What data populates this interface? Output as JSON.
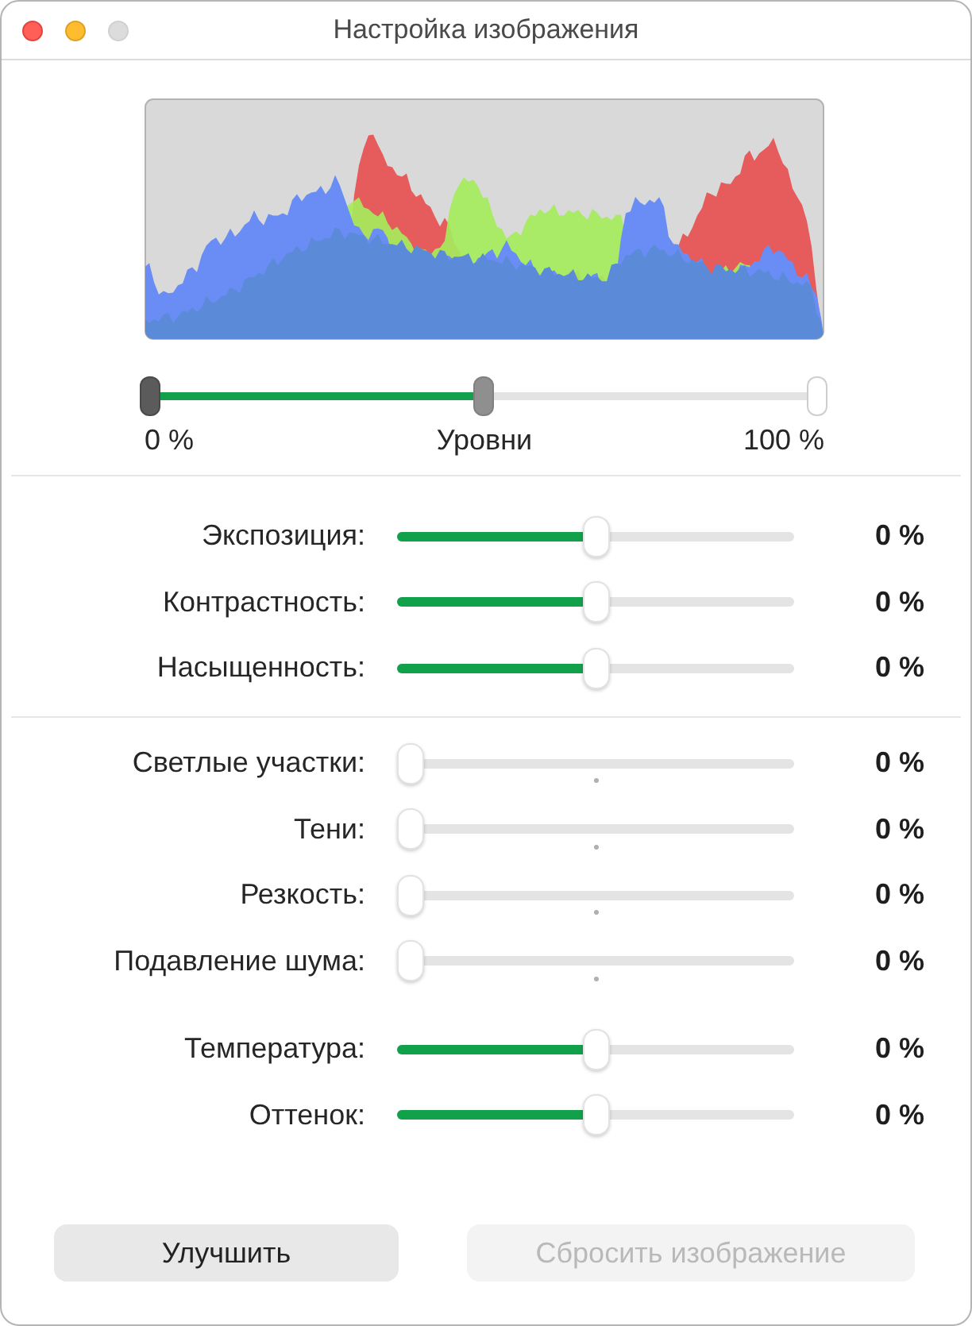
{
  "window": {
    "title": "Настройка изображения",
    "buttons": [
      {
        "kind": "close",
        "disabled": false
      },
      {
        "kind": "minimize",
        "disabled": false
      },
      {
        "kind": "zoom",
        "disabled": true
      }
    ]
  },
  "levels": {
    "thumbs": [
      {
        "kind": "low",
        "level": 0
      },
      {
        "kind": "mid",
        "level": 0.5
      },
      {
        "kind": "high",
        "level": 1
      }
    ],
    "min_label": "0 %",
    "title": "Уровни",
    "max_label": "100 %"
  },
  "sections": [
    {
      "sliders": [
        {
          "label": "Экспозиция:",
          "kind": "centered",
          "level": 0.5,
          "value": "0 %"
        },
        {
          "label": "Контрастность:",
          "kind": "centered",
          "level": 0.5,
          "value": "0 %"
        },
        {
          "label": "Насыщенность:",
          "kind": "centered",
          "level": 0.5,
          "value": "0 %"
        }
      ]
    },
    {
      "sliders": [
        {
          "label": "Светлые участки:",
          "kind": "ticked",
          "level": 0,
          "value": "0 %"
        },
        {
          "label": "Тени:",
          "kind": "ticked",
          "level": 0,
          "value": "0 %"
        },
        {
          "label": "Резкость:",
          "kind": "ticked",
          "level": 0,
          "value": "0 %"
        },
        {
          "label": "Подавление шума:",
          "kind": "ticked",
          "level": 0,
          "value": "0 %"
        },
        {
          "label": "Температура:",
          "kind": "centered",
          "level": 0.5,
          "value": "0 %"
        },
        {
          "label": "Оттенок:",
          "kind": "centered",
          "level": 0.5,
          "value": "0 %"
        }
      ]
    }
  ],
  "buttons": [
    {
      "label": "Улучшить",
      "disabled": false
    },
    {
      "label": "Сбросить изображение",
      "disabled": true
    }
  ]
}
